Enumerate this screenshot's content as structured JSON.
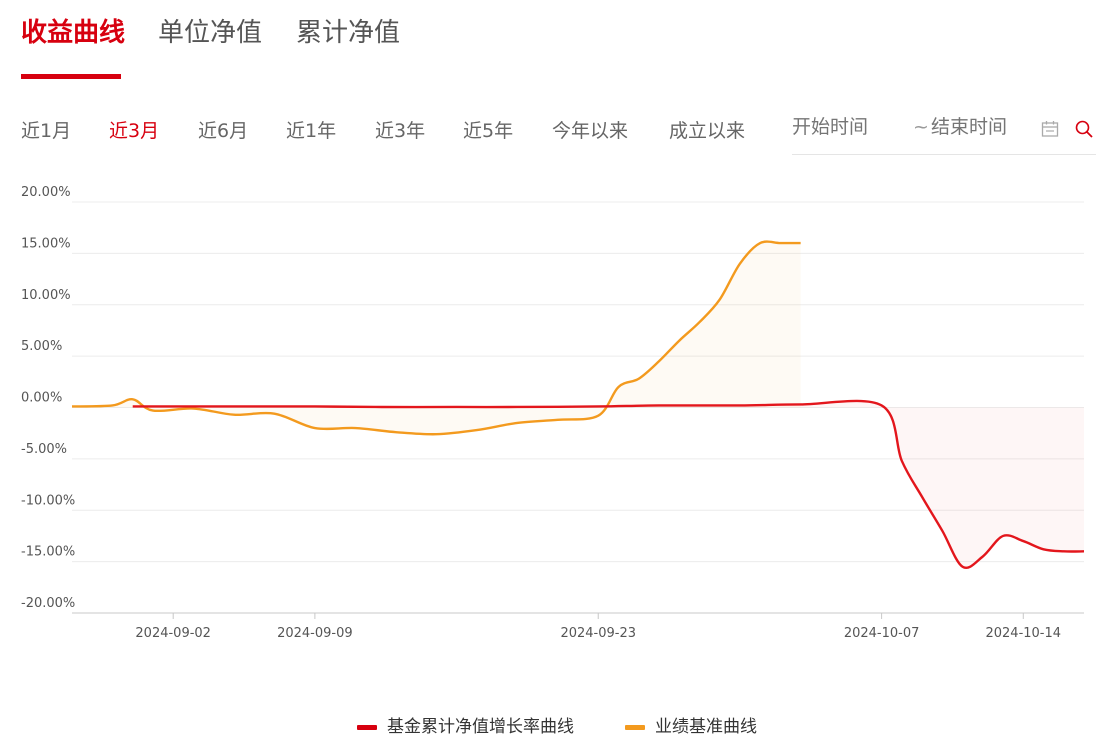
{
  "tabs": [
    {
      "label": "收益曲线",
      "active": true
    },
    {
      "label": "单位净值",
      "active": false
    },
    {
      "label": "累计净值",
      "active": false
    }
  ],
  "ranges": [
    {
      "label": "近1月",
      "active": false
    },
    {
      "label": "近3月",
      "active": true
    },
    {
      "label": "近6月",
      "active": false
    },
    {
      "label": "近1年",
      "active": false
    },
    {
      "label": "近3年",
      "active": false
    },
    {
      "label": "近5年",
      "active": false
    },
    {
      "label": "今年以来",
      "active": false
    },
    {
      "label": "成立以来",
      "active": false
    }
  ],
  "date_filter": {
    "start_placeholder": "开始时间",
    "separator": "~",
    "end_placeholder": "结束时间",
    "calendar_icon": "calendar-icon",
    "search_icon": "search-icon"
  },
  "colors": {
    "accent": "#d7000f",
    "fund_line": "#e3161c",
    "benchmark_line": "#f39a1e"
  },
  "chart_data": {
    "type": "line",
    "y_ticks": [
      "20.00%",
      "15.00%",
      "10.00%",
      "5.00%",
      "0.00%",
      "-5.00%",
      "-10.00%",
      "-15.00%",
      "-20.00%"
    ],
    "ylim": [
      -20,
      20
    ],
    "x_ticks": [
      "2024-09-02",
      "2024-09-09",
      "2024-09-23",
      "2024-10-07",
      "2024-10-14"
    ],
    "xlim": [
      "2024-08-28",
      "2024-10-17"
    ],
    "grid": true,
    "legend_position": "bottom",
    "series": [
      {
        "name": "基金累计净值增长率曲线",
        "color": "#e3161c",
        "area": true,
        "x": [
          "2024-08-31",
          "2024-09-03",
          "2024-09-06",
          "2024-09-09",
          "2024-09-12",
          "2024-09-16",
          "2024-09-19",
          "2024-09-23",
          "2024-09-26",
          "2024-09-30",
          "2024-10-03",
          "2024-10-07",
          "2024-10-08",
          "2024-10-09",
          "2024-10-10",
          "2024-10-11",
          "2024-10-12",
          "2024-10-13",
          "2024-10-14",
          "2024-10-15",
          "2024-10-16",
          "2024-10-17"
        ],
        "y": [
          0.1,
          0.1,
          0.1,
          0.1,
          0.05,
          0.05,
          0.05,
          0.1,
          0.2,
          0.2,
          0.3,
          0.2,
          -5.2,
          -8.7,
          -12,
          -15.5,
          -14.5,
          -12.5,
          -13,
          -13.8,
          -14,
          -14
        ]
      },
      {
        "name": "业绩基准曲线",
        "color": "#f39a1e",
        "area": true,
        "x": [
          "2024-08-28",
          "2024-08-30",
          "2024-08-31",
          "2024-09-01",
          "2024-09-03",
          "2024-09-05",
          "2024-09-07",
          "2024-09-09",
          "2024-09-11",
          "2024-09-13",
          "2024-09-15",
          "2024-09-17",
          "2024-09-19",
          "2024-09-21",
          "2024-09-23",
          "2024-09-24",
          "2024-09-25",
          "2024-09-26",
          "2024-09-27",
          "2024-09-28",
          "2024-09-29",
          "2024-09-30",
          "2024-10-01",
          "2024-10-02",
          "2024-10-03"
        ],
        "y": [
          0.1,
          0.2,
          0.8,
          -0.3,
          -0.1,
          -0.7,
          -0.6,
          -2.0,
          -2.0,
          -2.4,
          -2.6,
          -2.2,
          -1.5,
          -1.2,
          -0.8,
          2.0,
          2.8,
          4.5,
          6.5,
          8.3,
          10.5,
          14.0,
          16.0,
          16.0,
          16.0
        ]
      }
    ]
  },
  "legend": [
    {
      "label": "基金累计净值增长率曲线",
      "color": "#d7000f"
    },
    {
      "label": "业绩基准曲线",
      "color": "#f39a1e"
    }
  ]
}
